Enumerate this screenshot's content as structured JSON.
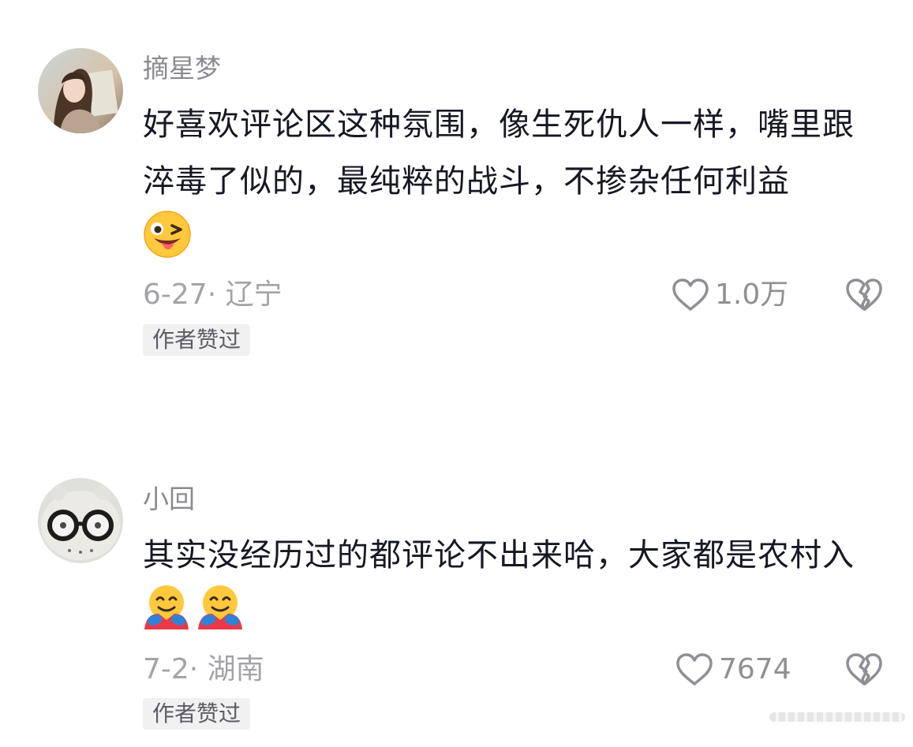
{
  "comments": [
    {
      "username": "摘星梦",
      "text": "好喜欢评论区这种氛围，像生死仇人一样，嘴里跟淬毒了似的，最纯粹的战斗，不掺杂任何利益",
      "emojis": [
        "winking-face-with-tongue"
      ],
      "date_location": "6-27· 辽宁",
      "likes": "1.0万",
      "badge": "作者赞过",
      "avatar": "girl-photo-avatar"
    },
    {
      "username": "小回",
      "text": "其实没经历过的都评论不出来哈，大家都是农村入",
      "emojis": [
        "hugging-face",
        "hugging-face"
      ],
      "date_location": "7-2· 湖南",
      "likes": "7674",
      "badge": "作者赞过",
      "avatar": "glasses-toy-avatar"
    }
  ],
  "icons": {
    "like": "heart-outline-icon",
    "dislike": "broken-heart-icon"
  },
  "colors": {
    "text_primary": "#161823",
    "text_secondary": "#8a8b91",
    "badge_bg": "#f1f1f2"
  }
}
